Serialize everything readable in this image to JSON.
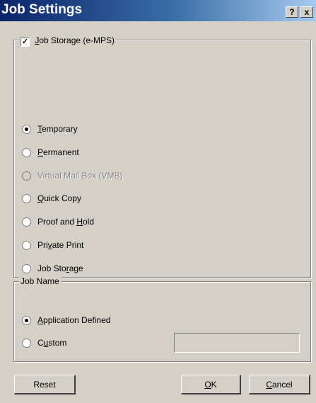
{
  "window": {
    "title": "Job Settings",
    "help_label": "?",
    "close_label": "x"
  },
  "job_storage": {
    "label_prefix": "J",
    "label_rest": "ob Storage (e-MPS)",
    "checked_mark": "✓",
    "options": [
      {
        "pre": "",
        "u": "T",
        "post": "emporary",
        "selected": true,
        "disabled": false
      },
      {
        "pre": "",
        "u": "P",
        "post": "ermanent",
        "selected": false,
        "disabled": false
      },
      {
        "pre": "Virtual Mail Box (VMB)",
        "u": "",
        "post": "",
        "selected": false,
        "disabled": true
      },
      {
        "pre": "",
        "u": "Q",
        "post": "uick Copy",
        "selected": false,
        "disabled": false
      },
      {
        "pre": "Proof and ",
        "u": "H",
        "post": "old",
        "selected": false,
        "disabled": false
      },
      {
        "pre": "Pri",
        "u": "v",
        "post": "ate Print",
        "selected": false,
        "disabled": false
      },
      {
        "pre": "Job Sto",
        "u": "r",
        "post": "age",
        "selected": false,
        "disabled": false
      }
    ]
  },
  "job_name": {
    "legend": "Job Name",
    "options": [
      {
        "pre": "",
        "u": "A",
        "post": "pplication Defined",
        "selected": true
      },
      {
        "pre": "C",
        "u": "u",
        "post": "stom",
        "selected": false
      }
    ],
    "custom_value": ""
  },
  "buttons": {
    "reset": "Reset",
    "ok_u": "O",
    "ok_rest": "K",
    "cancel_u": "C",
    "cancel_rest": "ancel"
  }
}
